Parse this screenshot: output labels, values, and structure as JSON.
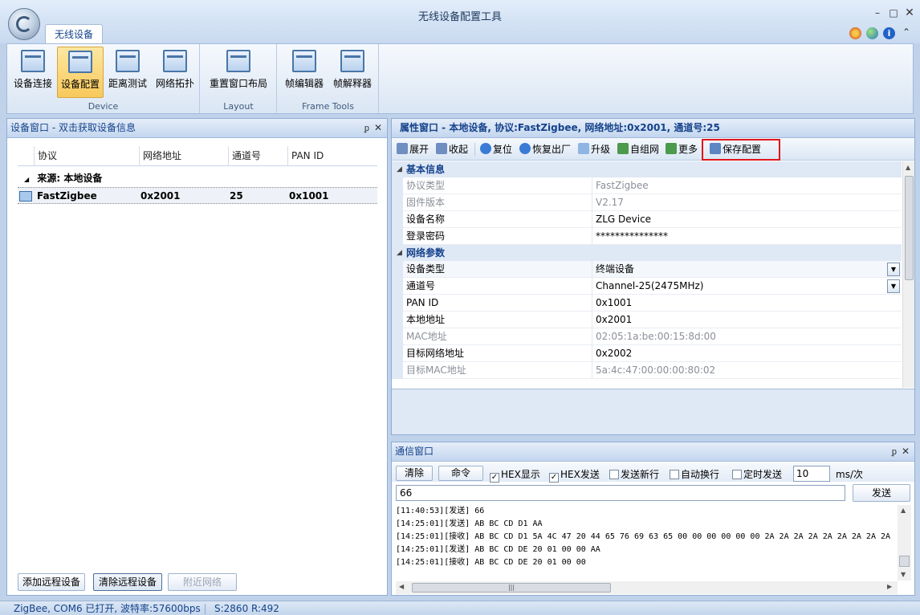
{
  "window": {
    "title": "无线设备配置工具",
    "min_glyph": "–",
    "max_glyph": "□",
    "close_glyph": "✕"
  },
  "ribbon": {
    "tab": "无线设备",
    "groups": [
      {
        "label": "Device",
        "buttons": [
          {
            "label": "设备连接",
            "icon": "connect-icon"
          },
          {
            "label": "设备配置",
            "icon": "config-icon",
            "active": true
          },
          {
            "label": "距离测试",
            "icon": "range-test-icon"
          },
          {
            "label": "网络拓扑",
            "icon": "topology-icon"
          }
        ]
      },
      {
        "label": "Layout",
        "buttons": [
          {
            "label": "重置窗口布局",
            "icon": "layout-icon"
          }
        ]
      },
      {
        "label": "Frame Tools",
        "buttons": [
          {
            "label": "帧编辑器",
            "icon": "frame-editor-icon"
          },
          {
            "label": "帧解释器",
            "icon": "frame-parser-icon"
          }
        ]
      }
    ]
  },
  "device_pane": {
    "title": "设备窗口 - 双击获取设备信息",
    "pin_glyph": "ᵱ",
    "close_glyph": "✕",
    "columns": [
      "协议",
      "网络地址",
      "通道号",
      "PAN ID"
    ],
    "group_label": "来源: 本地设备",
    "group_toggle": "◢",
    "row": {
      "protocol": "FastZigbee",
      "address": "0x2001",
      "channel": "25",
      "pan_id": "0x1001"
    },
    "buttons": {
      "add_remote": "添加远程设备",
      "clear_remote": "清除远程设备",
      "nearby": "附近网络"
    }
  },
  "property_pane": {
    "title": "属性窗口 - 本地设备, 协议:FastZigbee, 网络地址:0x2001, 通道号:25",
    "toolbar": {
      "expand": "展开",
      "collapse": "收起",
      "reset": "复位",
      "factory": "恢复出厂",
      "upgrade": "升级",
      "self_network": "自组网",
      "more": "更多",
      "save": "保存配置"
    },
    "categories": [
      {
        "name": "基本信息",
        "rows": [
          {
            "name": "协议类型",
            "value": "FastZigbee",
            "readonly": true
          },
          {
            "name": "固件版本",
            "value": "V2.17",
            "readonly": true
          },
          {
            "name": "设备名称",
            "value": "ZLG Device",
            "readonly": false
          },
          {
            "name": "登录密码",
            "value": "***************",
            "readonly": false
          }
        ]
      },
      {
        "name": "网络参数",
        "rows": [
          {
            "name": "设备类型",
            "value": "终端设备",
            "readonly": false,
            "dropdown": true
          },
          {
            "name": "通道号",
            "value": "Channel-25(2475MHz)",
            "readonly": false,
            "dropdown": true
          },
          {
            "name": "PAN ID",
            "value": "0x1001",
            "readonly": false
          },
          {
            "name": "本地地址",
            "value": "0x2001",
            "readonly": false
          },
          {
            "name": "MAC地址",
            "value": "02:05:1a:be:00:15:8d:00",
            "readonly": true
          },
          {
            "name": "目标网络地址",
            "value": "0x2002",
            "readonly": false
          },
          {
            "name": "目标MAC地址",
            "value": "5a:4c:47:00:00:00:80:02",
            "readonly": true
          }
        ]
      }
    ],
    "category_toggle": "◢",
    "dropdown_glyph": "▼"
  },
  "comm_pane": {
    "title": "通信窗口",
    "clear": "清除",
    "command": "命令",
    "hex_display": "HEX显示",
    "hex_send": "HEX发送",
    "send_newline": "发送新行",
    "auto_wrap": "自动换行",
    "timed_send": "定时发送",
    "hex_display_checked": true,
    "hex_send_checked": true,
    "send_newline_checked": false,
    "auto_wrap_checked": false,
    "timed_send_checked": false,
    "interval": "10",
    "interval_unit": "ms/次",
    "input_value": "66",
    "send": "发送",
    "log": [
      "[11:40:53][发送] 66",
      "[14:25:01][发送] AB BC CD D1 AA",
      "[14:25:01][接收] AB BC CD D1 5A 4C 47 20 44 65 76 69 63 65 00 00 00 00 00 00 2A 2A 2A 2A 2A 2A 2A 2A 2A",
      "[14:25:01][发送] AB BC CD DE 20 01 00 00 AA",
      "[14:25:01][接收] AB BC CD DE 20 01 00 00"
    ],
    "check_glyph": "✓",
    "scroll_grip": "|||",
    "scroll_left": "◀",
    "scroll_right": "▶",
    "scroll_up": "▲",
    "scroll_down": "▼"
  },
  "status": {
    "port": "ZigBee, COM6 已打开, 波特率:57600bps",
    "counts": "S:2860  R:492"
  },
  "colors": {
    "accent": "#15428b",
    "highlight_border": "#e0161d",
    "active_button": "#f8c95b"
  }
}
